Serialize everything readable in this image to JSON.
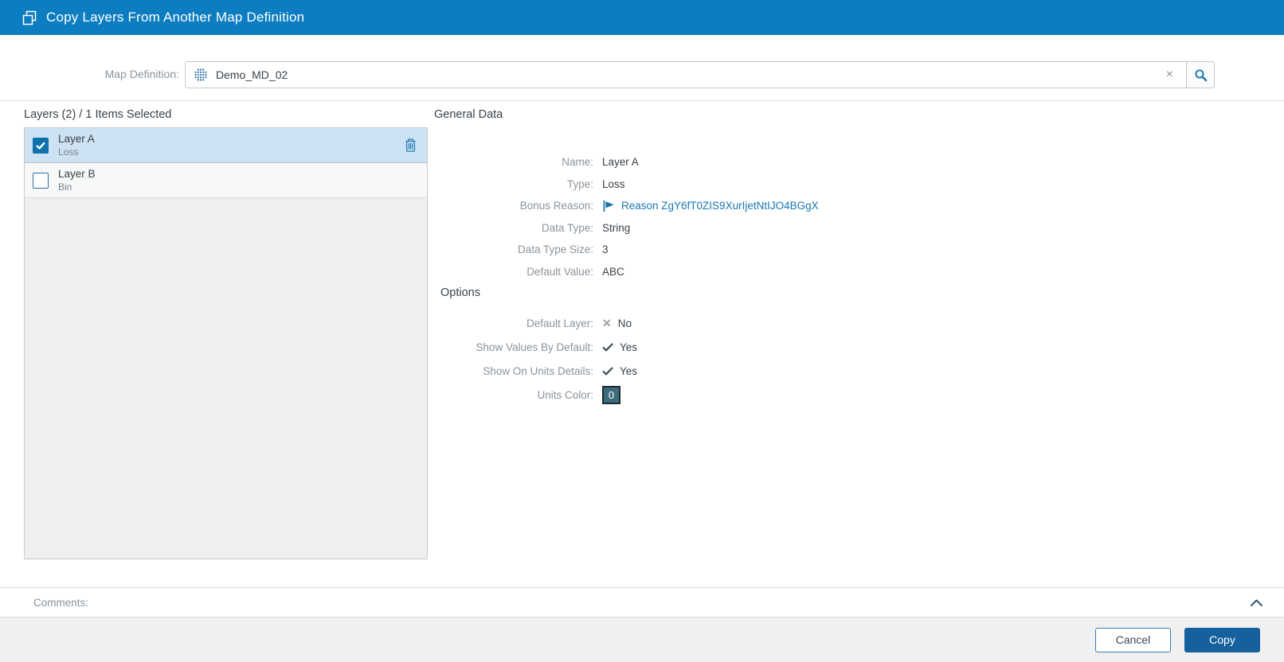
{
  "window": {
    "title": "Copy Layers From Another Map Definition"
  },
  "map_definition": {
    "label": "Map Definition:",
    "value": "Demo_MD_02",
    "clear_glyph": "×"
  },
  "layers": {
    "header": "Layers (2) / 1 Items Selected",
    "items": [
      {
        "name": "Layer A",
        "type": "Loss",
        "checked": true,
        "selected": true
      },
      {
        "name": "Layer B",
        "type": "Bin",
        "checked": false,
        "selected": false
      }
    ]
  },
  "general": {
    "title": "General Data",
    "fields": [
      {
        "label": "Name:",
        "value": "Layer A"
      },
      {
        "label": "Type:",
        "value": "Loss"
      },
      {
        "label": "Bonus Reason:",
        "value": "Reason ZgY6fT0ZIS9XurIjetNtIJO4BGgX"
      },
      {
        "label": "Data Type:",
        "value": "String"
      },
      {
        "label": "Data Type Size:",
        "value": "3"
      },
      {
        "label": "Default Value:",
        "value": "ABC"
      }
    ]
  },
  "options": {
    "title": "Options",
    "fields": [
      {
        "label": "Default Layer:",
        "value": "No",
        "state": "no"
      },
      {
        "label": "Show Values By Default:",
        "value": "Yes",
        "state": "yes"
      },
      {
        "label": "Show On Units Details:",
        "value": "Yes",
        "state": "yes"
      },
      {
        "label": "Units Color:",
        "value": "0",
        "state": "color",
        "swatch_color": "#3c6b7c"
      }
    ]
  },
  "comments": {
    "label": "Comments:"
  },
  "footer": {
    "cancel": "Cancel",
    "copy": "Copy"
  },
  "colors": {
    "header_bg": "#0d7dc1",
    "accent_blue": "#2a7ab0",
    "link_blue": "#1878b4",
    "checkbox_blue": "#0f72ad",
    "selected_row_bg": "#cde2f2",
    "copy_button_bg": "#15619e",
    "units_swatch": "#3c6b7c"
  }
}
